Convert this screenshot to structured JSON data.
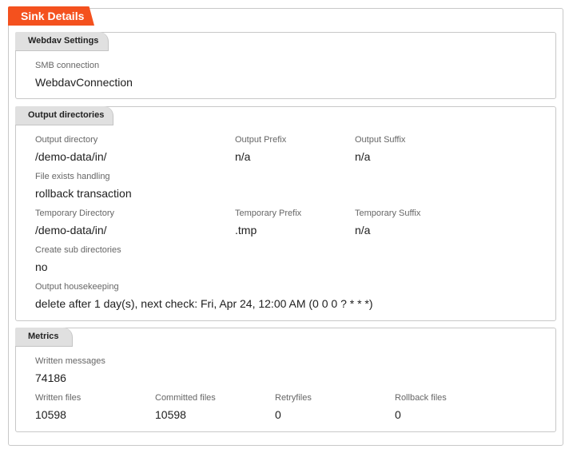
{
  "title": "Sink Details",
  "webdav": {
    "title": "Webdav Settings",
    "smb_label": "SMB connection",
    "smb_value": "WebdavConnection"
  },
  "output": {
    "title": "Output directories",
    "dir_label": "Output directory",
    "dir_value": "/demo-data/in/",
    "prefix_label": "Output Prefix",
    "prefix_value": "n/a",
    "suffix_label": "Output Suffix",
    "suffix_value": "n/a",
    "exists_label": "File exists handling",
    "exists_value": "rollback transaction",
    "tmpdir_label": "Temporary Directory",
    "tmpdir_value": "/demo-data/in/",
    "tmpprefix_label": "Temporary Prefix",
    "tmpprefix_value": ".tmp",
    "tmpsuffix_label": "Temporary Suffix",
    "tmpsuffix_value": "n/a",
    "subdirs_label": "Create sub directories",
    "subdirs_value": "no",
    "housekeeping_label": "Output housekeeping",
    "housekeeping_value": "delete after 1 day(s), next check: Fri, Apr 24, 12:00 AM (0 0 0 ? * * *)"
  },
  "metrics": {
    "title": "Metrics",
    "written_messages_label": "Written messages",
    "written_messages_value": "74186",
    "written_files_label": "Written files",
    "written_files_value": "10598",
    "committed_files_label": "Committed files",
    "committed_files_value": "10598",
    "retryfiles_label": "Retryfiles",
    "retryfiles_value": "0",
    "rollback_files_label": "Rollback files",
    "rollback_files_value": "0"
  }
}
